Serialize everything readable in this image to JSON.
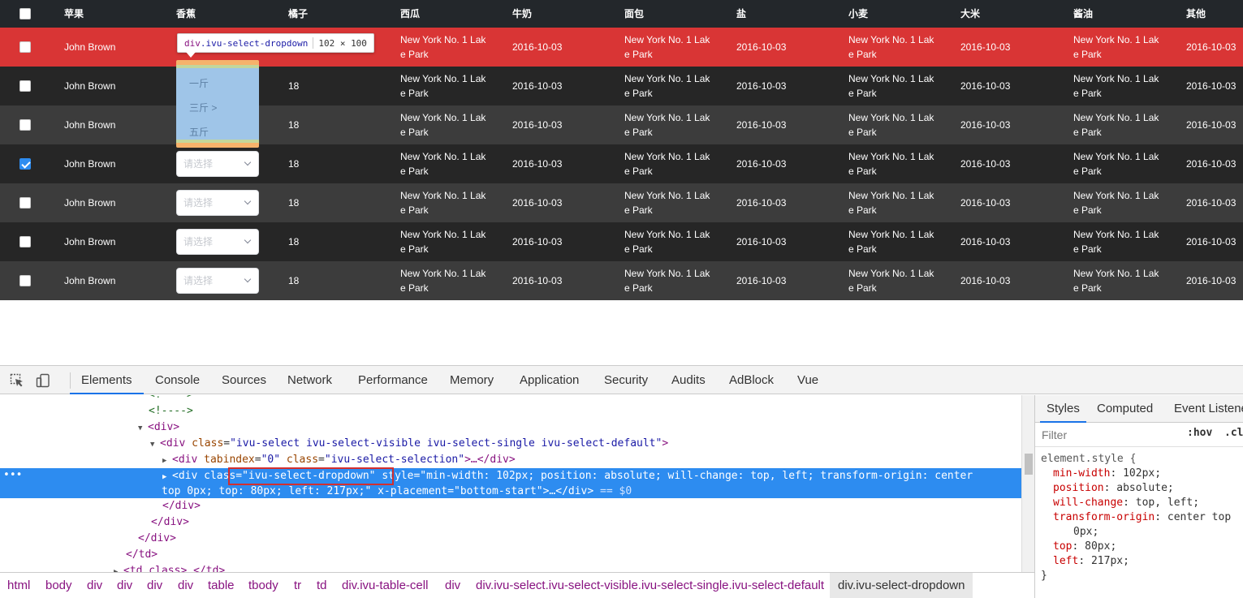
{
  "table": {
    "columns": [
      "苹果",
      "香蕉",
      "橘子",
      "西瓜",
      "牛奶",
      "面包",
      "盐",
      "小麦",
      "大米",
      "酱油",
      "其他"
    ],
    "rows": [
      {
        "name": "John Brown",
        "age": "",
        "address": "New York No. 1 Lake Park",
        "date": "2016-10-03",
        "checked": false,
        "style": "red",
        "select": false
      },
      {
        "name": "John Brown",
        "age": "18",
        "address": "New York No. 1 Lake Park",
        "date": "2016-10-03",
        "checked": false,
        "style": "dark",
        "select": false
      },
      {
        "name": "John Brown",
        "age": "18",
        "address": "New York No. 1 Lake Park",
        "date": "2016-10-03",
        "checked": false,
        "style": "light",
        "select": false
      },
      {
        "name": "John Brown",
        "age": "18",
        "address": "New York No. 1 Lake Park",
        "date": "2016-10-03",
        "checked": true,
        "style": "dark",
        "select": true
      },
      {
        "name": "John Brown",
        "age": "18",
        "address": "New York No. 1 Lake Park",
        "date": "2016-10-03",
        "checked": false,
        "style": "light",
        "select": true
      },
      {
        "name": "John Brown",
        "age": "18",
        "address": "New York No. 1 Lake Park",
        "date": "2016-10-03",
        "checked": false,
        "style": "dark",
        "select": true
      },
      {
        "name": "John Brown",
        "age": "18",
        "address": "New York No. 1 Lake Park",
        "date": "2016-10-03",
        "checked": false,
        "style": "light",
        "select": true
      }
    ],
    "select_placeholder": "请选择"
  },
  "dropdown": {
    "options": [
      "一斤",
      "三斤 >",
      "五斤"
    ]
  },
  "tooltip": {
    "tag": "div",
    "class": ".ivu-select-dropdown",
    "size": "102 × 100"
  },
  "devtools": {
    "tabs": [
      "Elements",
      "Console",
      "Sources",
      "Network",
      "Performance",
      "Memory",
      "Application",
      "Security",
      "Audits",
      "AdBlock",
      "Vue"
    ],
    "active_tab": "Elements",
    "dom_lines": {
      "c1": "<!---->",
      "c2": "<!---->",
      "div_open": "<div>",
      "select_attr": "class",
      "select_val": "\"ivu-select ivu-select-visible ivu-select-single ivu-select-default\"",
      "selection_tabindex_val": "\"0\"",
      "selection_class_val": "\"ivu-select-selection\"",
      "dropdown_class_val": "\"ivu-select-dropdown\"",
      "dropdown_style_highlight": "style=\"min-width: 102px;",
      "dropdown_style_rest": " position: absolute; will-change: top, left; transform-origin: center",
      "dropdown_style_line2": "top 0px; top: 80px; left: 217px;\" x-placement=\"bottom-start\">…</div>",
      "dropdown_eq": " == $0",
      "div_close1": "</div>",
      "div_close2": "</div>",
      "div_close3": "</div>",
      "td_close": "</td>",
      "td_next": "<td class>…</td>"
    },
    "breadcrumbs": [
      "html",
      "body",
      "div",
      "div",
      "div",
      "div",
      "table",
      "tbody",
      "tr",
      "td",
      "div.ivu-table-cell",
      "div",
      "div.ivu-select.ivu-select-visible.ivu-select-single.ivu-select-default",
      "div.ivu-select-dropdown"
    ],
    "styles_tabs": [
      "Styles",
      "Computed",
      "Event Listeners"
    ],
    "filter_placeholder": "Filter",
    "hov": ":hov",
    "cls": ".cls",
    "css": {
      "selector": "element.style {",
      "props": [
        {
          "prop": "min-width",
          "val": "102px;"
        },
        {
          "prop": "position",
          "val": "absolute;"
        },
        {
          "prop": "will-change",
          "val": "top, left;"
        },
        {
          "prop": "transform-origin",
          "val": "center top"
        },
        {
          "prop": "",
          "val": "0px;"
        },
        {
          "prop": "top",
          "val": "80px;"
        },
        {
          "prop": "left",
          "val": "217px;"
        }
      ],
      "close": "}"
    }
  }
}
